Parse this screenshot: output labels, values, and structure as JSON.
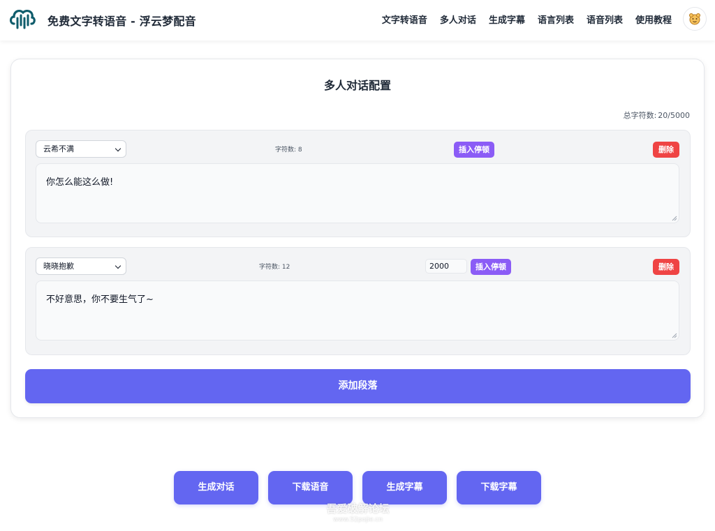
{
  "header": {
    "brand": "免费文字转语音 - 浮云梦配音",
    "nav": [
      "文字转语音",
      "多人对话",
      "生成字幕",
      "语言列表",
      "语音列表",
      "使用教程"
    ],
    "logo_icon": "sound-wave-logo-icon",
    "avatar_icon": "cartoon-avatar-icon"
  },
  "card": {
    "title": "多人对话配置",
    "total_label": "总字符数:",
    "total_value": "20/5000"
  },
  "segments": [
    {
      "voice": "云希不满",
      "char_count": "字符数: 8",
      "pause_ms": "",
      "pause_label": "插入停顿",
      "delete_label": "删除",
      "text": "你怎么能这么做!"
    },
    {
      "voice": "晓晓抱歉",
      "char_count": "字符数: 12",
      "pause_ms": "2000",
      "pause_label": "插入停顿",
      "delete_label": "删除",
      "text": "不好意思，你不要生气了~"
    }
  ],
  "add_label": "添加段落",
  "actions": [
    "生成对话",
    "下载语音",
    "生成字幕",
    "下载字幕"
  ],
  "watermark": {
    "main": "吾爱破解论坛",
    "sub": "www.52pojie.cn"
  },
  "colors": {
    "primary": "#6366f1",
    "pause": "#8b5cf6",
    "delete": "#ef4444",
    "logo": "#0f5c6b"
  }
}
